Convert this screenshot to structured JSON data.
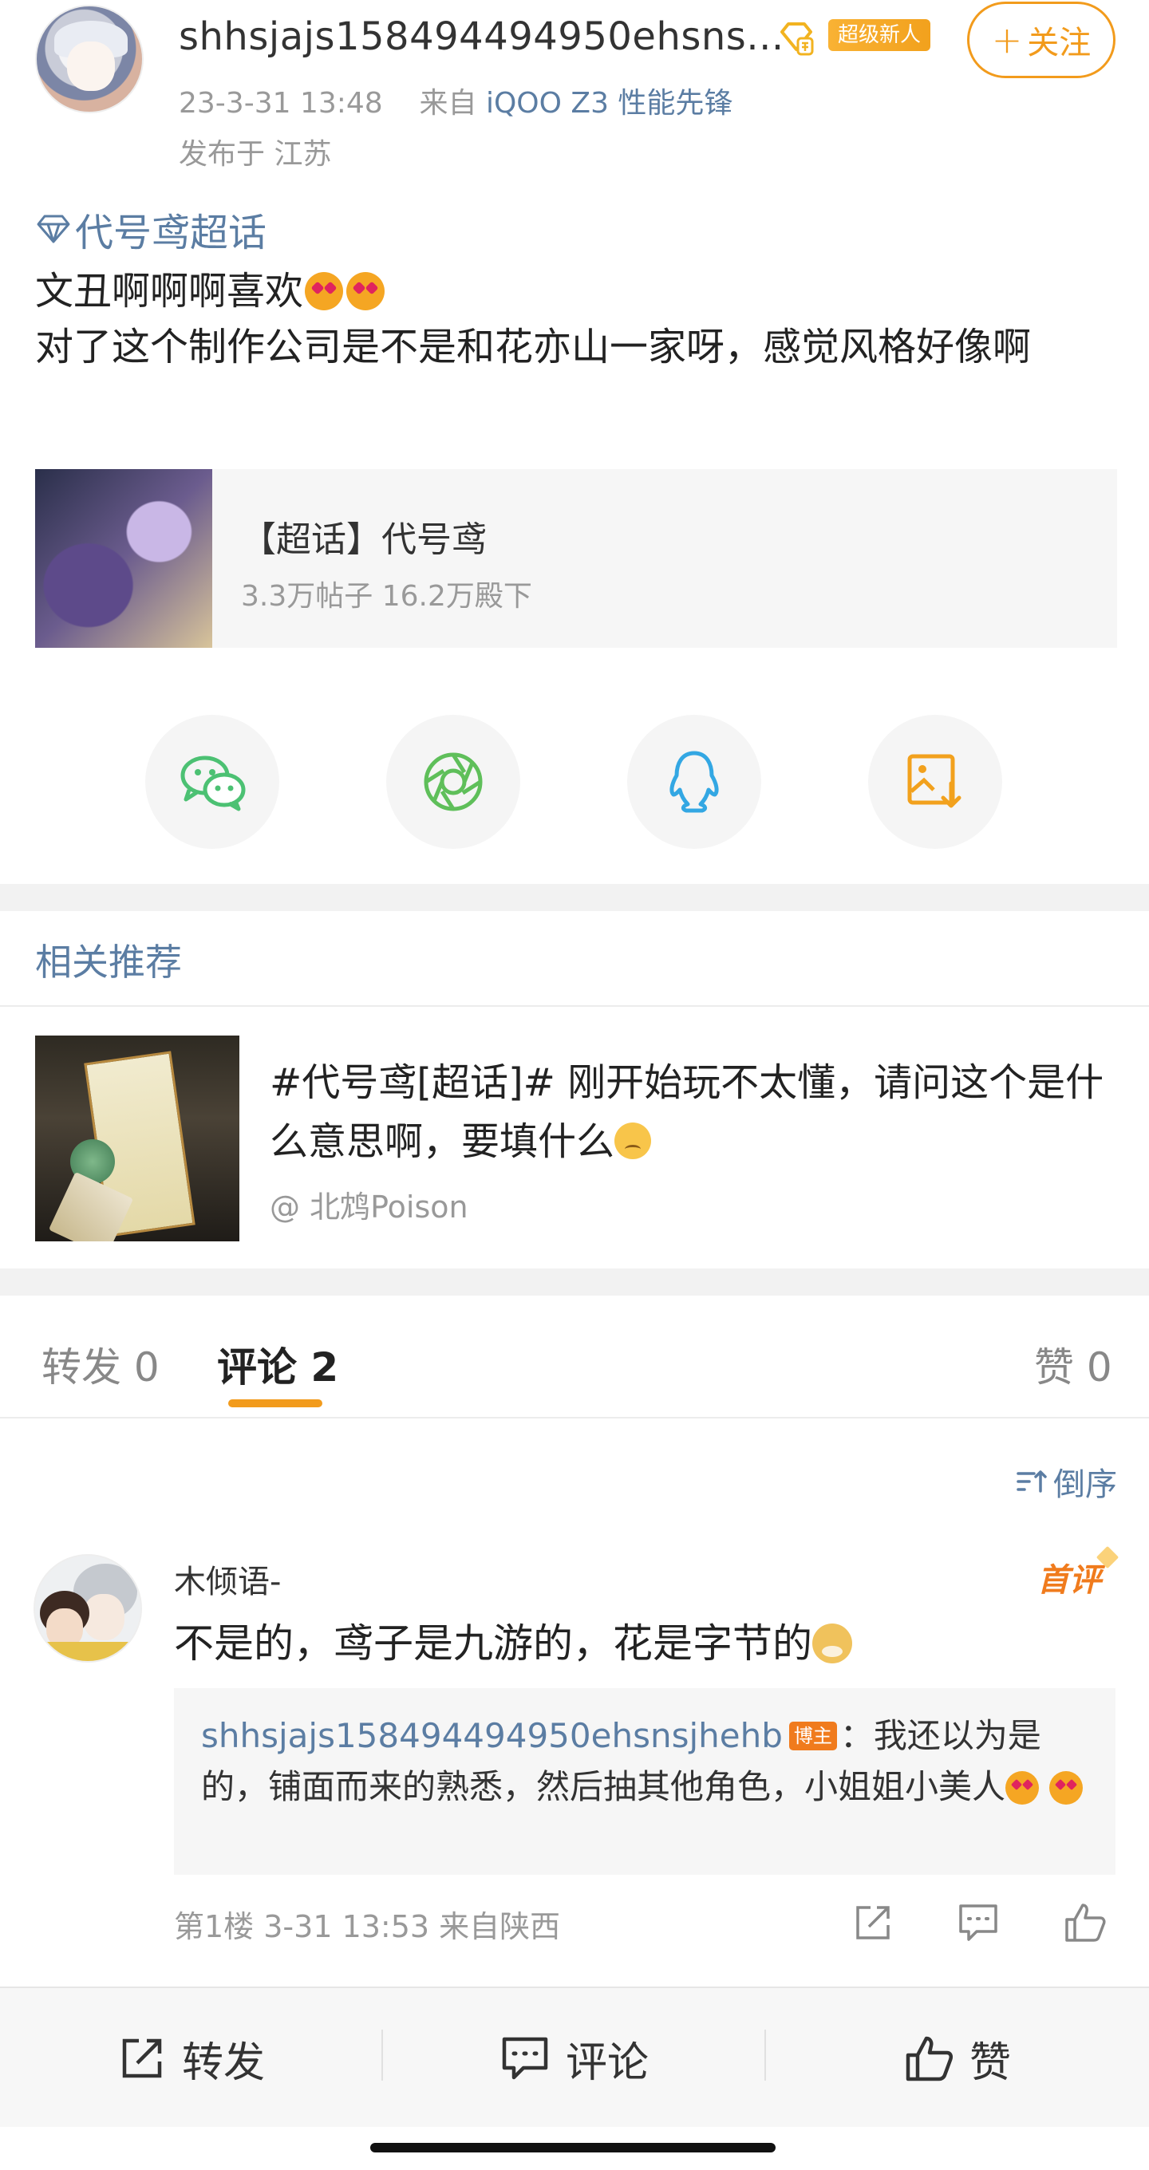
{
  "post": {
    "author_name": "shhsjajs158494494950ehsns...",
    "badge_text": "超级新人",
    "follow_label": "关注",
    "follow_plus": "+",
    "timestamp": "23-3-31 13:48",
    "source_prefix": "来自",
    "source_device": "iQOO Z3 性能先锋",
    "location": "发布于 江苏",
    "topic": "代号鸢超话",
    "text_line1": "文丑啊啊啊喜欢",
    "text_line2": "对了这个制作公司是不是和花亦山一家呀，感觉风格好像啊"
  },
  "topic_card": {
    "name": "【超话】代号鸢",
    "stats": "3.3万帖子 16.2万殿下"
  },
  "share": {
    "icons": [
      "wechat-icon",
      "moments-icon",
      "qq-icon",
      "save-image-icon"
    ],
    "colors": {
      "wechat": "#4cc173",
      "moments": "#5fbf5a",
      "qq": "#33a7e3",
      "save": "#f2a11d"
    }
  },
  "related": {
    "title": "相关推荐",
    "item_text": "#代号鸢[超话]# 刚开始玩不太懂，请问这个是什么意思啊，要填什么",
    "item_author": "@ 北鸩Poison"
  },
  "tabs": {
    "repost": "转发 0",
    "comments": "评论 2",
    "likes": "赞 0"
  },
  "sort_label": "倒序",
  "comment": {
    "name": "木倾语-",
    "first_badge": "首评",
    "text": "不是的，鸢子是九游的，花是字节的",
    "reply_name": "shhsjajs158494494950ehsnsjhehb",
    "reply_badge": "博主",
    "reply_text": "：我还以为是的，铺面而来的熟悉，然后抽其他角色，小姐姐小美人",
    "meta": "第1楼  3-31 13:53  来自陕西"
  },
  "bottom_bar": {
    "repost": "转发",
    "comment": "评论",
    "like": "赞"
  },
  "colors": {
    "accent": "#f29b1c",
    "link": "#5b7da3"
  }
}
